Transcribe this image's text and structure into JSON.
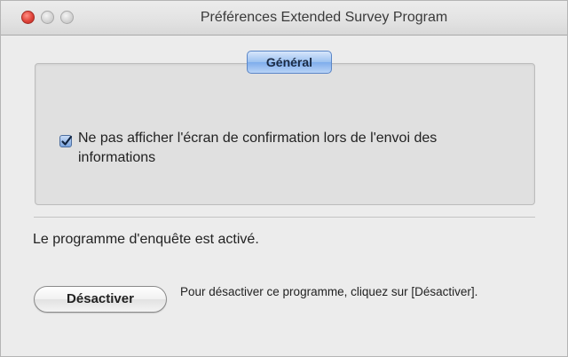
{
  "window": {
    "title": "Préférences Extended Survey Program"
  },
  "tabs": {
    "general_label": "Général"
  },
  "options": {
    "suppress_confirmation_label": "Ne pas afficher l'écran de confirmation lors de l'envoi des informations",
    "suppress_confirmation_checked": true
  },
  "status": {
    "text": "Le programme d'enquête est activé."
  },
  "actions": {
    "deactivate_label": "Désactiver",
    "deactivate_hint": "Pour désactiver ce programme, cliquez sur [Désactiver]."
  },
  "colors": {
    "close_light": "#e0443a",
    "tab_accent": "#7fadec",
    "checkbox_accent": "#7ba5df"
  }
}
